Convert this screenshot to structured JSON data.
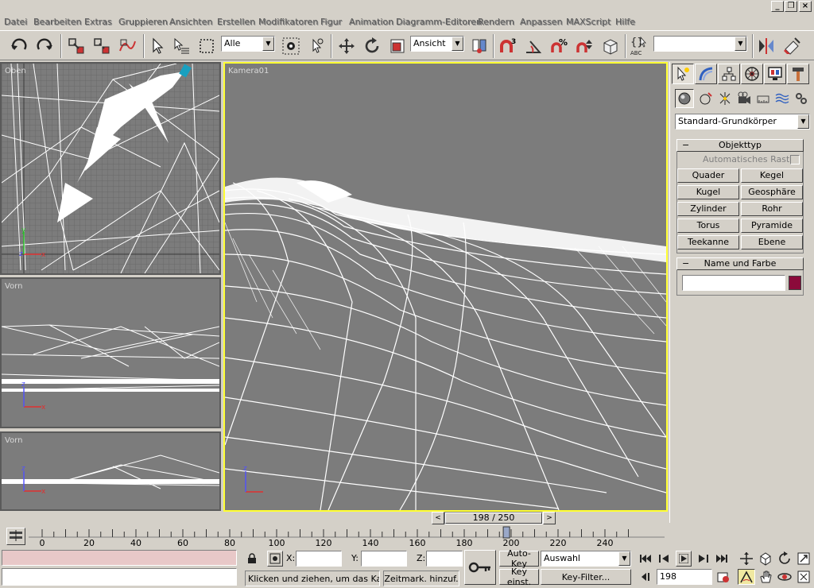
{
  "menu": [
    "Datei",
    "Bearbeiten",
    "Extras",
    "Gruppieren",
    "Ansichten",
    "Erstellen",
    "Modifikatoren",
    "Figur",
    "Animation",
    "Diagramm-Editoren",
    "Rendern",
    "Anpassen",
    "MAXScript",
    "Hilfe"
  ],
  "toolbar": {
    "selection_filter": "Alle",
    "reference_coord": "Ansicht",
    "named_selection": ""
  },
  "viewports": {
    "top": "Oben",
    "front": "Vorn",
    "left": "Vorn",
    "camera": "Kamera01"
  },
  "axes": {
    "x": "x",
    "y": "y",
    "z": "z"
  },
  "command_panel": {
    "category": "Standard-Grundkörper",
    "object_type": {
      "title": "Objekttyp",
      "auto_grid": "Automatisches Raster",
      "buttons": [
        "Quader",
        "Kegel",
        "Kugel",
        "Geosphäre",
        "Zylinder",
        "Rohr",
        "Torus",
        "Pyramide",
        "Teekanne",
        "Ebene"
      ]
    },
    "name_color": {
      "title": "Name und Farbe",
      "name_value": "",
      "color": "#8b0a3a"
    }
  },
  "time_slider": {
    "current": 198,
    "total": 250,
    "label": "198 / 250",
    "ticks": [
      "0",
      "20",
      "40",
      "60",
      "80",
      "100",
      "120",
      "140",
      "160",
      "180",
      "200",
      "220",
      "240"
    ]
  },
  "status": {
    "coord_labels": {
      "x": "X:",
      "y": "Y:",
      "z": "Z:"
    },
    "x": "",
    "y": "",
    "z": "",
    "prompt": "Klicken und ziehen, um das Kamera",
    "add_time_tag": "Zeitmark. hinzuf.",
    "auto_key": "Auto-Key",
    "set_key": "Key einst.",
    "key_mode": "Auswahl",
    "key_filters": "Key-Filter...",
    "current_frame": "198"
  },
  "colors": {
    "accent_active_viewport": "#ffff33",
    "status_bar_top": "#e8c8c8"
  }
}
